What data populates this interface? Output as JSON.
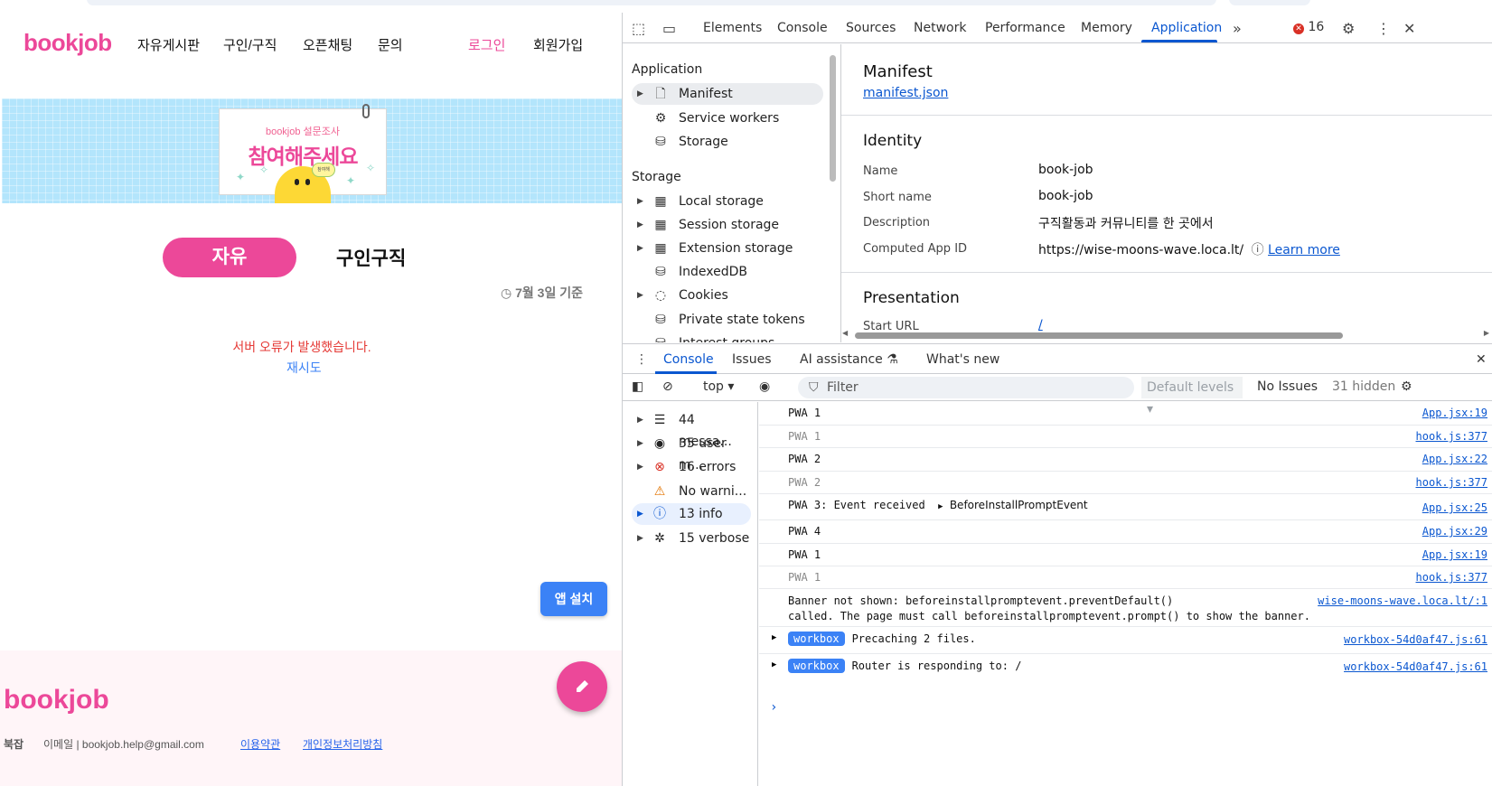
{
  "site": {
    "logo": "bookjob",
    "nav": [
      "자유게시판",
      "구인/구직",
      "오픈채팅",
      "문의"
    ],
    "login": "로그인",
    "signup": "회원가입",
    "banner_sub": "bookjob 설문조사",
    "banner_main": "참여해주세요",
    "banner_bubble": "참여해",
    "tab_active": "자유",
    "tab_inactive": "구인구직",
    "date_note": "7월 3일 기준",
    "error_message": "서버 오류가 발생했습니다.",
    "retry": "재시도",
    "app_install": "앱 설치",
    "footer_logo": "bookjob",
    "footer_label": "북잡",
    "footer_email": "이메일 | bookjob.help@gmail.com",
    "footer_terms": "이용약관",
    "footer_privacy": "개인정보처리방침"
  },
  "devtools": {
    "tabs": [
      "Elements",
      "Console",
      "Sources",
      "Network",
      "Performance",
      "Memory",
      "Application"
    ],
    "active_tab": "Application",
    "error_count": "16",
    "sidebar": {
      "application_header": "Application",
      "application_items": [
        "Manifest",
        "Service workers",
        "Storage"
      ],
      "storage_header": "Storage",
      "storage_items": [
        "Local storage",
        "Session storage",
        "Extension storage",
        "IndexedDB",
        "Cookies",
        "Private state tokens",
        "Interest groups"
      ]
    },
    "manifest": {
      "title": "Manifest",
      "link": "manifest.json",
      "identity_header": "Identity",
      "name_label": "Name",
      "name_value": "book-job",
      "short_name_label": "Short name",
      "short_name_value": "book-job",
      "description_label": "Description",
      "description_value": "구직활동과 커뮤니티를 한 곳에서",
      "app_id_label": "Computed App ID",
      "app_id_value": "https://wise-moons-wave.loca.lt/",
      "learn_more": "Learn more",
      "presentation_header": "Presentation",
      "start_url_label": "Start URL",
      "start_url_value": "/"
    },
    "drawer_tabs": [
      "Console",
      "Issues",
      "AI assistance",
      "What's new"
    ],
    "console_toolbar": {
      "context": "top",
      "filter_placeholder": "Filter",
      "levels": "Default levels",
      "issues": "No Issues",
      "hidden": "31 hidden"
    },
    "console_sidebar": [
      "44 messa...",
      "35 user m...",
      "16 errors",
      "No warni...",
      "13 info",
      "15 verbose"
    ],
    "logs": [
      {
        "msg": "PWA 1",
        "src": "App.jsx:19",
        "dim": false
      },
      {
        "msg": "PWA 1",
        "src": "hook.js:377",
        "dim": true
      },
      {
        "msg": "PWA 2",
        "src": "App.jsx:22",
        "dim": false
      },
      {
        "msg": "PWA 2",
        "src": "hook.js:377",
        "dim": true
      },
      {
        "msg": "PWA 3: Event received",
        "extra": "BeforeInstallPromptEvent",
        "src": "App.jsx:25",
        "dim": false
      },
      {
        "msg": "PWA 4",
        "src": "App.jsx:29",
        "dim": false
      },
      {
        "msg": "PWA 1",
        "src": "App.jsx:19",
        "dim": false
      },
      {
        "msg": "PWA 1",
        "src": "hook.js:377",
        "dim": true
      }
    ],
    "banner_log": {
      "line1": "Banner not shown: beforeinstallpromptevent.preventDefault()",
      "line2": "called. The page must call beforeinstallpromptevent.prompt() to show the banner.",
      "src": "wise-moons-wave.loca.lt/:1"
    },
    "workbox_logs": [
      {
        "badge": "workbox",
        "msg": "Precaching 2 files.",
        "src": "workbox-54d0af47.js:61"
      },
      {
        "badge": "workbox",
        "msg": "Router is responding to: /",
        "src": "workbox-54d0af47.js:61"
      }
    ]
  }
}
